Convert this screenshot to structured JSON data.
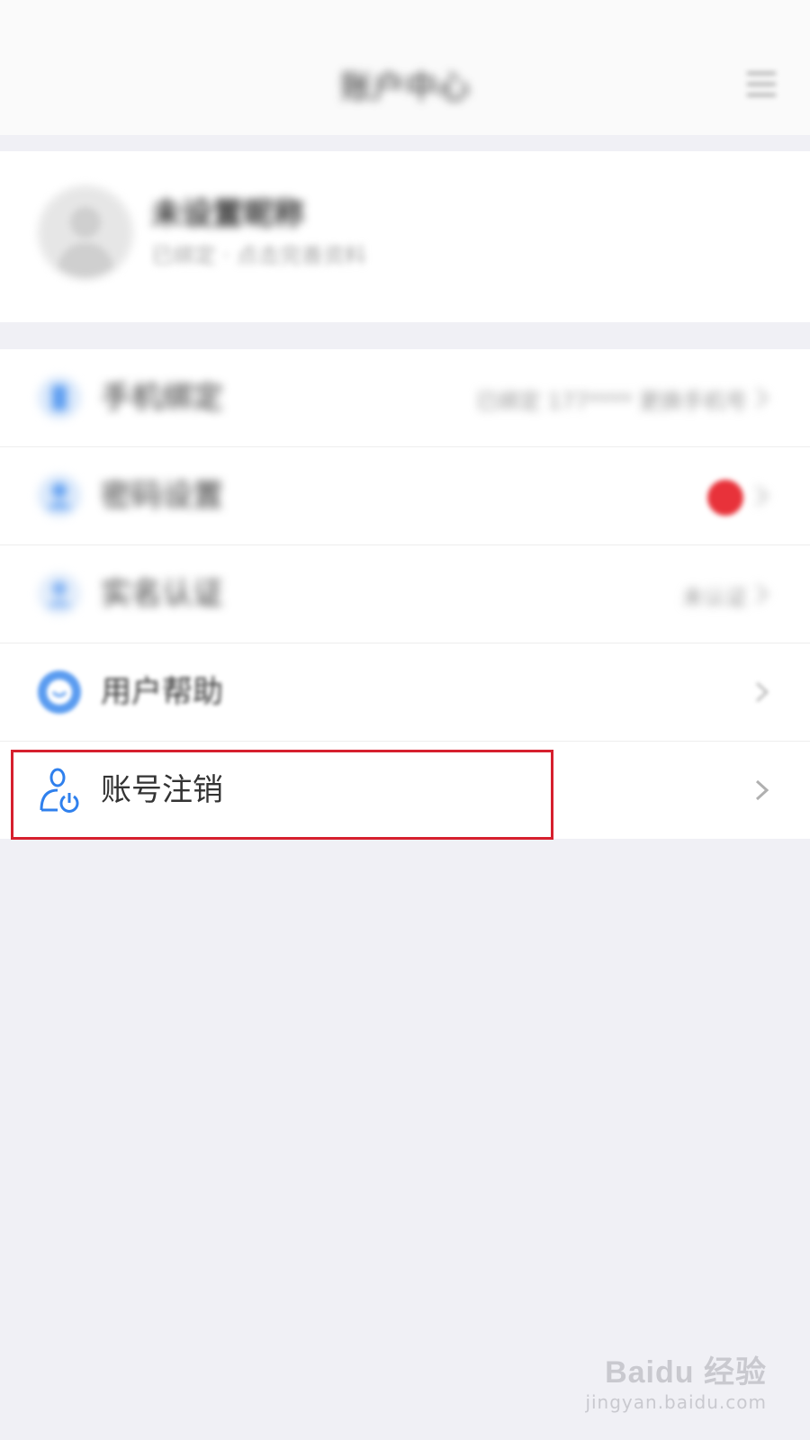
{
  "header": {
    "title": "账户中心",
    "menu_icon": "menu-icon"
  },
  "profile": {
    "name": "未设置昵称",
    "subtitle": "已绑定 · 点击完善资料",
    "avatar_icon": "default-avatar-icon"
  },
  "menu": {
    "items": [
      {
        "label": "手机绑定",
        "value": "已绑定 177**** 更换手机号",
        "icon": "phone-icon",
        "color": "#5b9cf0"
      },
      {
        "label": "密码设置",
        "value": "",
        "icon": "user-lock-icon",
        "color": "#5b9cf0",
        "badge": true
      },
      {
        "label": "实名认证",
        "value": "未认证",
        "icon": "user-verify-icon",
        "color": "#5b9cf0"
      },
      {
        "label": "用户帮助",
        "value": "",
        "icon": "help-icon",
        "color": "#5b9cf0"
      },
      {
        "label": "账号注销",
        "value": "",
        "icon": "user-power-icon",
        "color": "#2f80ed"
      }
    ]
  },
  "colors": {
    "accent": "#2f80ed",
    "highlight_border": "#d6202e",
    "badge": "#e8323a",
    "background": "#f0f0f5"
  },
  "watermark": {
    "logo": "Baidu 经验",
    "url": "jingyan.baidu.com"
  }
}
